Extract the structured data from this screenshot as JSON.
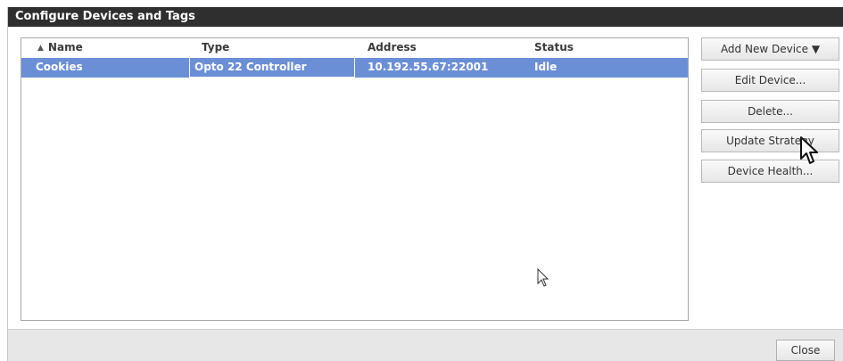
{
  "dialog": {
    "title": "Configure Devices and Tags"
  },
  "table": {
    "sort_indicator": "▲",
    "columns": [
      "Name",
      "Type",
      "Address",
      "Status"
    ],
    "rows": [
      {
        "name": "Cookies",
        "type": "Opto 22 Controller",
        "address": "10.192.55.67:22001",
        "status": "Idle"
      }
    ]
  },
  "buttons": {
    "add_new_device": "Add New Device ▼",
    "edit_device": "Edit Device...",
    "delete": "Delete...",
    "update_strategy": "Update Strategy",
    "device_health": "Device Health...",
    "close": "Close"
  },
  "colors": {
    "titlebar": "#2f2f2f",
    "selection": "#6b8fd6",
    "footer": "#e7e7e7"
  },
  "icons": {
    "cursor_over_button": "arrow-cursor-icon",
    "cursor_in_table": "arrow-cursor-icon"
  }
}
